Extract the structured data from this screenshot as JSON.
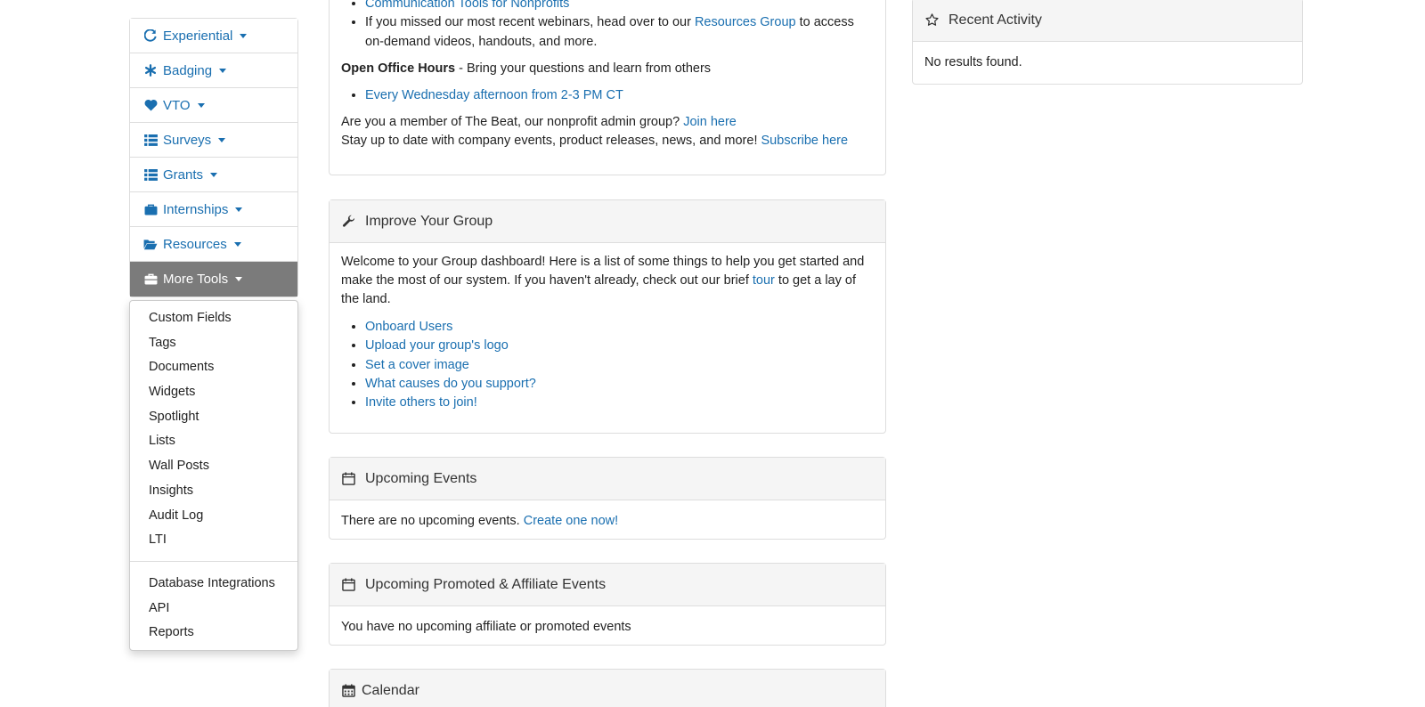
{
  "nav": {
    "items": [
      {
        "label": "Experiential",
        "icon": "refresh-icon"
      },
      {
        "label": "Badging",
        "icon": "asterisk-icon"
      },
      {
        "label": "VTO",
        "icon": "heart-icon"
      },
      {
        "label": "Surveys",
        "icon": "list-icon"
      },
      {
        "label": "Grants",
        "icon": "list-icon"
      },
      {
        "label": "Internships",
        "icon": "briefcase-icon"
      },
      {
        "label": "Resources",
        "icon": "folder-open-icon"
      },
      {
        "label": "More Tools",
        "icon": "toolbox-icon"
      }
    ]
  },
  "dropdown": {
    "group1": [
      "Custom Fields",
      "Tags",
      "Documents",
      "Widgets",
      "Spotlight",
      "Lists",
      "Wall Posts",
      "Insights",
      "Audit Log",
      "LTI"
    ],
    "group2": [
      "Database Integrations",
      "API",
      "Reports"
    ]
  },
  "top_panel": {
    "link_comm_tools": "Communication Tools for Nonprofits",
    "webinar_text_1": "If you missed our most recent webinars, head over to our",
    "resources_group_link": "Resources Group",
    "webinar_text_2": "to access on-demand videos, handouts, and more.",
    "office_hours_label": "Open Office Hours",
    "office_hours_text": " - Bring your questions and learn from others",
    "office_hours_link": "Every Wednesday afternoon from 2-3 PM CT",
    "beat_text": "Are you a member of The Beat, our nonprofit admin group?",
    "beat_link": "Join here",
    "subscribe_text": "Stay up to date with company events, product releases, news, and more!",
    "subscribe_link": "Subscribe here"
  },
  "improve": {
    "title": "Improve Your Group",
    "intro_1": "Welcome to your Group dashboard! Here is a list of some things to help you get started and make the most of our system. If you haven't already, check out our brief",
    "tour_link": "tour",
    "intro_2": "to get a lay of the land.",
    "links": [
      "Onboard Users",
      "Upload your group's logo",
      "Set a cover image",
      "What causes do you support?",
      "Invite others to join!"
    ]
  },
  "upcoming_events": {
    "title": "Upcoming Events",
    "text": "There are no upcoming events.",
    "link": "Create one now!"
  },
  "promoted_events": {
    "title": "Upcoming Promoted & Affiliate Events",
    "text": "You have no upcoming affiliate or promoted events"
  },
  "calendar": {
    "title": "Calendar"
  },
  "recent_activity": {
    "title": "Recent Activity",
    "text": "No results found."
  },
  "colors": {
    "link": "#1a6fb0",
    "active_nav_bg": "#7b7b7b",
    "panel_head_bg": "#f5f5f5"
  }
}
